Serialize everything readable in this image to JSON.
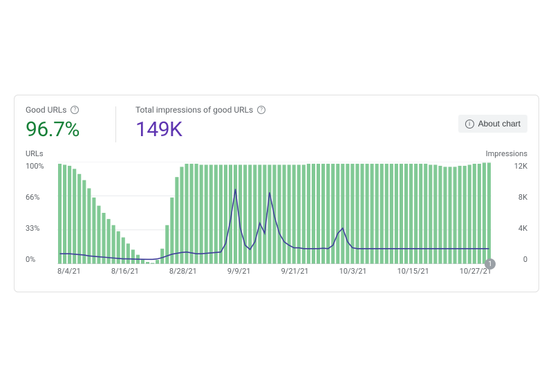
{
  "metrics": {
    "good_urls": {
      "label": "Good URLs",
      "value": "96.7%"
    },
    "impressions": {
      "label": "Total impressions of good URLs",
      "value": "149K"
    }
  },
  "about_button": "About chart",
  "left_axis": {
    "title": "URLs",
    "ticks": [
      "100%",
      "66%",
      "33%",
      "0%"
    ]
  },
  "right_axis": {
    "title": "Impressions",
    "ticks": [
      "12K",
      "8K",
      "4K",
      "0"
    ]
  },
  "x_ticks": [
    "8/4/21",
    "8/16/21",
    "8/28/21",
    "9/9/21",
    "9/21/21",
    "10/3/21",
    "10/15/21",
    "10/27/21"
  ],
  "badge": "1",
  "chart_data": {
    "type": "bar+line",
    "title": "",
    "x_start": "2021-08-04",
    "x_end": "2021-10-31",
    "left_ylabel": "URLs (% good)",
    "left_ylim": [
      0,
      100
    ],
    "right_ylabel": "Impressions",
    "right_ylim": [
      0,
      12000
    ],
    "series": [
      {
        "name": "Good URLs %",
        "axis": "left",
        "kind": "bar",
        "values": [
          98,
          97,
          96,
          93,
          88,
          82,
          74,
          65,
          57,
          50,
          44,
          38,
          32,
          26,
          20,
          14,
          9,
          5,
          2,
          1,
          4,
          15,
          38,
          65,
          85,
          95,
          98,
          98,
          98,
          97,
          97,
          97,
          97,
          97,
          97,
          97,
          97,
          97,
          97,
          97,
          97,
          97,
          97,
          97,
          97,
          97,
          97,
          97,
          97,
          97,
          97,
          98,
          98,
          98,
          98,
          98,
          98,
          98,
          98,
          98,
          98,
          98,
          98,
          98,
          98,
          98,
          98,
          98,
          98,
          98,
          98,
          98,
          98,
          98,
          98,
          98,
          97,
          97,
          96,
          95,
          95,
          95,
          96,
          96,
          97,
          98,
          98,
          99,
          99
        ]
      },
      {
        "name": "Impressions",
        "axis": "right",
        "kind": "line",
        "values": [
          1200,
          1200,
          1200,
          1150,
          1100,
          1050,
          950,
          900,
          850,
          800,
          750,
          700,
          650,
          600,
          600,
          580,
          560,
          550,
          540,
          540,
          600,
          750,
          950,
          1150,
          1250,
          1350,
          1400,
          1300,
          1200,
          1200,
          1250,
          1300,
          1350,
          1400,
          2400,
          5200,
          8800,
          4200,
          2200,
          1700,
          2600,
          4800,
          3600,
          8400,
          5600,
          3600,
          2600,
          2200,
          1900,
          1900,
          1800,
          1800,
          1800,
          1800,
          1850,
          1800,
          2200,
          3600,
          4200,
          2600,
          1900,
          1800,
          1800,
          1800,
          1800,
          1800,
          1800,
          1800,
          1800,
          1800,
          1800,
          1800,
          1800,
          1800,
          1800,
          1800,
          1800,
          1800,
          1800,
          1800,
          1800,
          1800,
          1800,
          1800,
          1800,
          1800,
          1800,
          1800,
          1800
        ]
      }
    ]
  }
}
